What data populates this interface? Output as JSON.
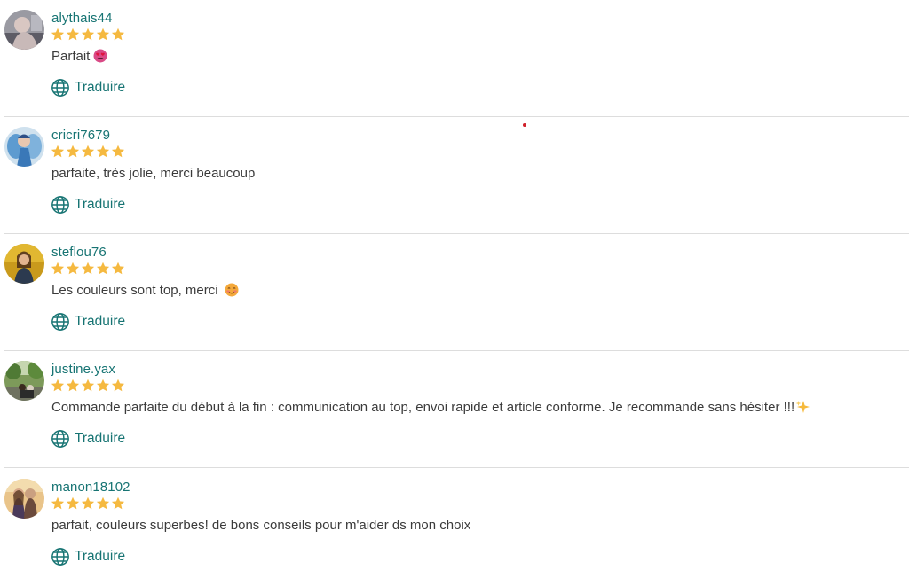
{
  "icons": {
    "star": "star-icon",
    "translate": "globe-icon"
  },
  "colors": {
    "link_teal": "#177473",
    "star_yellow": "#F5B940",
    "divider": "#dddddd",
    "body_text": "#3b3b3b"
  },
  "reviews": [
    {
      "username": "alythais44",
      "rating": 5,
      "text": "Parfait",
      "emoji": "heart-eyes-emoji",
      "translate_label": "Traduire"
    },
    {
      "username": "cricri7679",
      "rating": 5,
      "text": "parfaite, très jolie, merci beaucoup",
      "emoji": "",
      "translate_label": "Traduire"
    },
    {
      "username": "steflou76",
      "rating": 5,
      "text": "Les couleurs sont top, merci",
      "emoji": "smiling-blushing-emoji",
      "translate_label": "Traduire"
    },
    {
      "username": "justine.yax",
      "rating": 5,
      "text": "Commande parfaite du début à la fin : communication au top, envoi rapide et article conforme. Je recommande sans hésiter !!!",
      "emoji": "sparkles-emoji",
      "translate_label": "Traduire"
    },
    {
      "username": "manon18102",
      "rating": 5,
      "text": "parfait, couleurs superbes! de bons conseils pour m'aider ds mon choix",
      "emoji": "",
      "translate_label": "Traduire"
    }
  ]
}
